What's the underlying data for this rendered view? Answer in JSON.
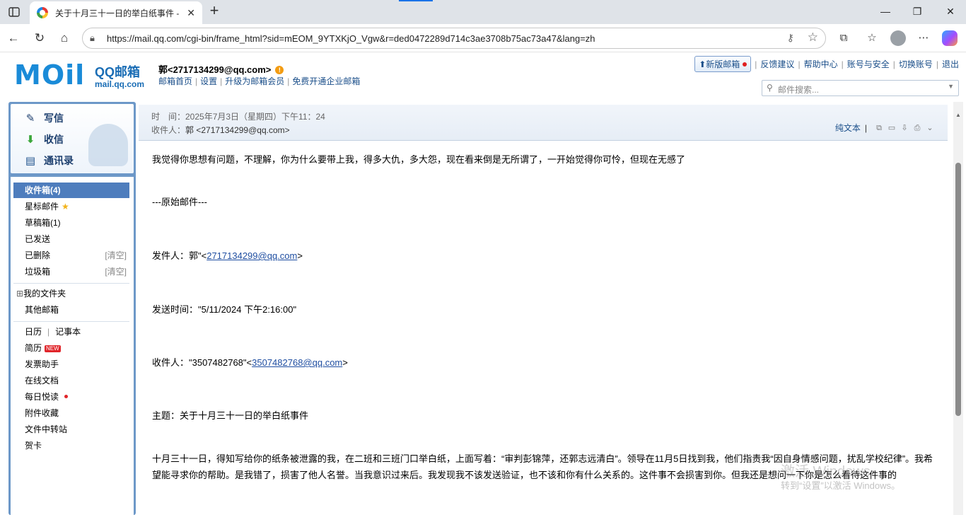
{
  "browser": {
    "tab_title": "关于十月三十一日的举白纸事件 -",
    "url": "https://mail.qq.com/cgi-bin/frame_html?sid=mEOM_9YTXKjO_Vgw&r=ded0472289d714c3ae3708b75ac73a47&lang=zh"
  },
  "header": {
    "logo_mark": "MOil",
    "logo_name": "QQ邮箱",
    "logo_domain": "mail.qq.com",
    "account": "郭<2717134299@qq.com>",
    "links": [
      "邮箱首页",
      "设置",
      "升级为邮箱会员",
      "免费开通企业邮箱"
    ],
    "right_links": {
      "new_version": "新版邮箱",
      "feedback": "反馈建议",
      "help": "帮助中心",
      "security": "账号与安全",
      "switch": "切换账号",
      "logout": "退出"
    },
    "search_placeholder": "邮件搜索..."
  },
  "sidebar": {
    "compose": "写信",
    "inbox_quick": "收信",
    "contacts": "通讯录",
    "folders": [
      {
        "label": "收件箱(4)",
        "aux": ""
      },
      {
        "label": "星标邮件",
        "aux": ""
      },
      {
        "label": "草稿箱(1)",
        "aux": ""
      },
      {
        "label": "已发送",
        "aux": ""
      },
      {
        "label": "已删除",
        "aux": "[清空]"
      },
      {
        "label": "垃圾箱",
        "aux": "[清空]"
      }
    ],
    "my_folders": "我的文件夹",
    "other_mail": "其他邮箱",
    "calendar": "日历",
    "notes": "记事本",
    "resume": "简历",
    "new_badge": "NEW",
    "tools": [
      "发票助手",
      "在线文档",
      "每日悦读",
      "附件收藏",
      "文件中转站",
      "贺卡"
    ]
  },
  "mail": {
    "time_line": "时　间：2025年7月3日（星期四）下午11：24",
    "to_label": "收件人：",
    "to_value": "郭 <2717134299@qq.com>",
    "plain_text": "纯文本",
    "line1": "我觉得你思想有问题，不理解，你为什么要带上我，得多大仇，多大怨，现在看来倒是无所谓了，一开始觉得你可怜，但现在无感了",
    "original": "---原始邮件---",
    "from_prefix": "发件人：郭\"<",
    "from_email": "2717134299@qq.com",
    "from_suffix": ">",
    "sent_time": "发送时间：\"5/11/2024 下午2:16:00\"",
    "to2_prefix": "收件人：\"3507482768\"<",
    "to2_email": "3507482768@qq.com",
    "to2_suffix": ">",
    "subject": "主题：关于十月三十一日的举白纸事件",
    "para": "十月三十一日，得知写给你的纸条被泄露的我，在二班和三班门口举白纸，上面写着：“审判彭锦萍，还郭志远清白”。领导在11月5日找到我，他们指责我“因自身情感问题，扰乱学校纪律”。我希望能寻求你的帮助。是我错了，损害了他人名誉。当我意识过来后。我发现我不该发送验证，也不该和你有什么关系的。这件事不会损害到你。但我还是想问一下你是怎么看待这件事的"
  },
  "watermark": {
    "line1": "激活 Windows",
    "line2": "转到“设置”以激活 Windows。"
  }
}
